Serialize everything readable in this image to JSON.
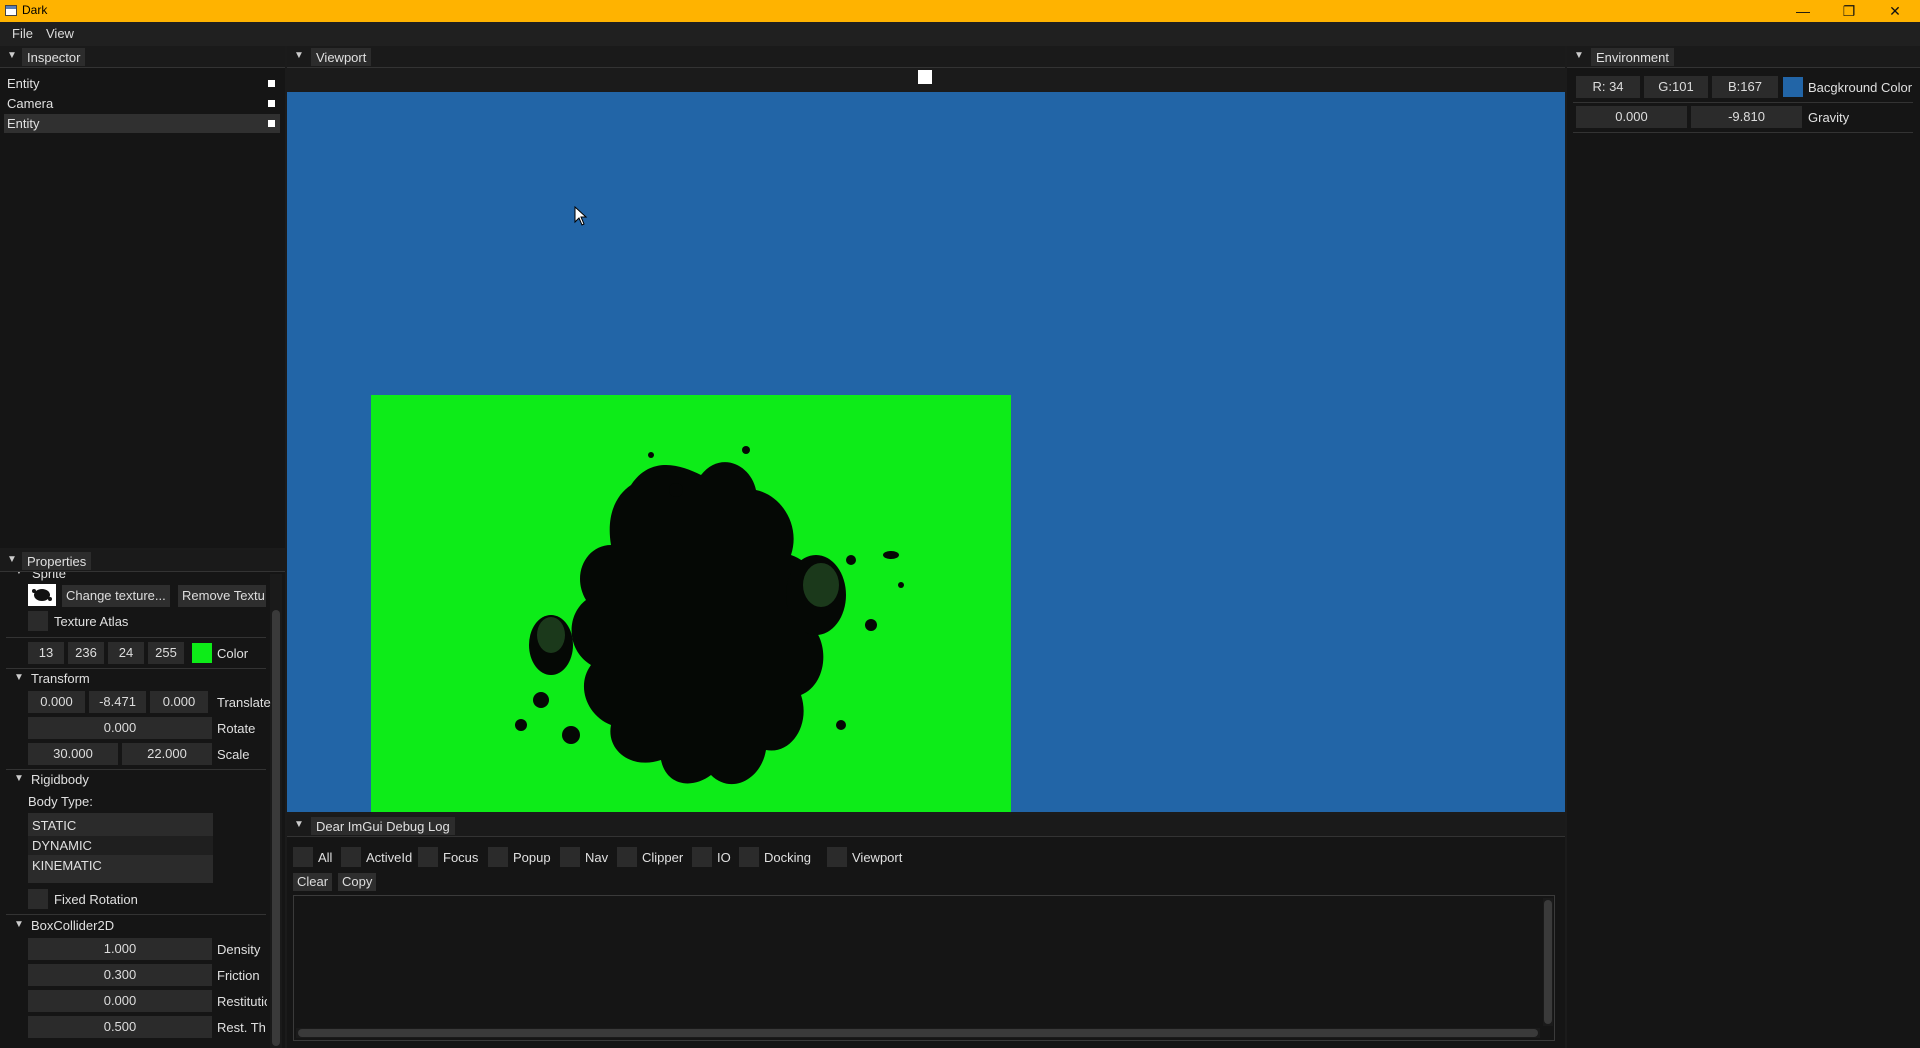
{
  "window": {
    "title": "Dark",
    "minimize": "—",
    "restore": "❐",
    "close": "✕"
  },
  "menu": {
    "items": [
      "File",
      "View"
    ]
  },
  "inspector": {
    "tab": "Inspector",
    "entities": [
      {
        "name": "Entity",
        "selected": false
      },
      {
        "name": "Camera",
        "selected": false
      },
      {
        "name": "Entity",
        "selected": true
      }
    ]
  },
  "viewport": {
    "tab": "Viewport",
    "background_color": "#2265a7",
    "sprite_color": "#0dec18"
  },
  "environment": {
    "tab": "Environment",
    "r": "R: 34",
    "g": "G:101",
    "b": "B:167",
    "swatch_color": "#2265a7",
    "bg_label": "Bacgkround Color",
    "gravity_x": "0.000",
    "gravity_y": "-9.810",
    "gravity_label": "Gravity"
  },
  "properties": {
    "tab": "Properties",
    "sprite": {
      "header": "Sprite",
      "change_texture": "Change texture...",
      "remove_texture": "Remove Textu",
      "texture_atlas": "Texture Atlas",
      "color_r": "13",
      "color_g": "236",
      "color_b": "24",
      "color_a": "255",
      "color_label": "Color",
      "swatch_color": "#0dec18"
    },
    "transform": {
      "header": "Transform",
      "tx": "0.000",
      "ty": "-8.471",
      "tz": "0.000",
      "translate_label": "Translate",
      "rotate": "0.000",
      "rotate_label": "Rotate",
      "sx": "30.000",
      "sy": "22.000",
      "scale_label": "Scale"
    },
    "rigidbody": {
      "header": "Rigidbody",
      "body_type_label": "Body Type:",
      "options": [
        "STATIC",
        "DYNAMIC",
        "KINEMATIC"
      ],
      "selected": "DYNAMIC",
      "fixed_rotation": "Fixed Rotation"
    },
    "boxcollider": {
      "header": "BoxCollider2D",
      "density": "1.000",
      "density_label": "Density",
      "friction": "0.300",
      "friction_label": "Friction",
      "restitution": "0.000",
      "restitution_label": "Restitutic",
      "rest_th": "0.500",
      "rest_th_label": "Rest. Th"
    }
  },
  "debuglog": {
    "tab": "Dear ImGui Debug Log",
    "filters": [
      "All",
      "ActiveId",
      "Focus",
      "Popup",
      "Nav",
      "Clipper",
      "IO",
      "Docking",
      "Viewport"
    ],
    "clear": "Clear",
    "copy": "Copy"
  }
}
